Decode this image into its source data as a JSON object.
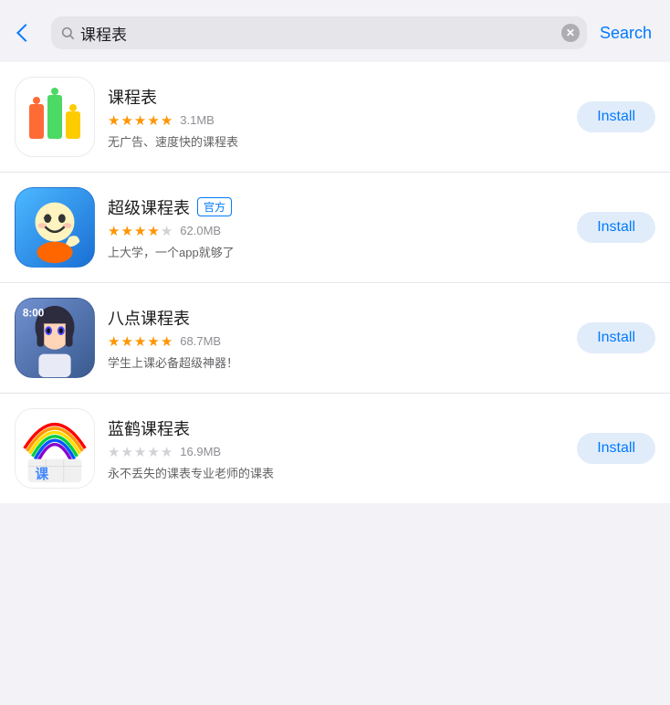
{
  "header": {
    "back_label": "",
    "search_value": "课程表",
    "clear_label": "×",
    "search_button_label": "Search"
  },
  "apps": [
    {
      "id": "kechengbiao",
      "name": "课程表",
      "official": false,
      "stars_full": 4,
      "stars_half": 1,
      "stars_empty": 0,
      "size": "3.1MB",
      "description": "无广告、速度快的课程表",
      "install_label": "Install"
    },
    {
      "id": "super",
      "name": "超级课程表",
      "official": true,
      "official_label": "官方",
      "stars_full": 4,
      "stars_half": 0,
      "stars_empty": 1,
      "size": "62.0MB",
      "description": "上大学，一个app就够了",
      "install_label": "Install"
    },
    {
      "id": "badianke",
      "name": "八点课程表",
      "official": false,
      "stars_full": 5,
      "stars_half": 0,
      "stars_empty": 0,
      "size": "68.7MB",
      "description": "学生上课必备超级神器！",
      "install_label": "Install"
    },
    {
      "id": "lanhe",
      "name": "蓝鹤课程表",
      "official": false,
      "stars_full": 0,
      "stars_half": 0,
      "stars_empty": 5,
      "size": "16.9MB",
      "description": "永不丢失的课表专业老师的课表",
      "install_label": "Install"
    }
  ]
}
